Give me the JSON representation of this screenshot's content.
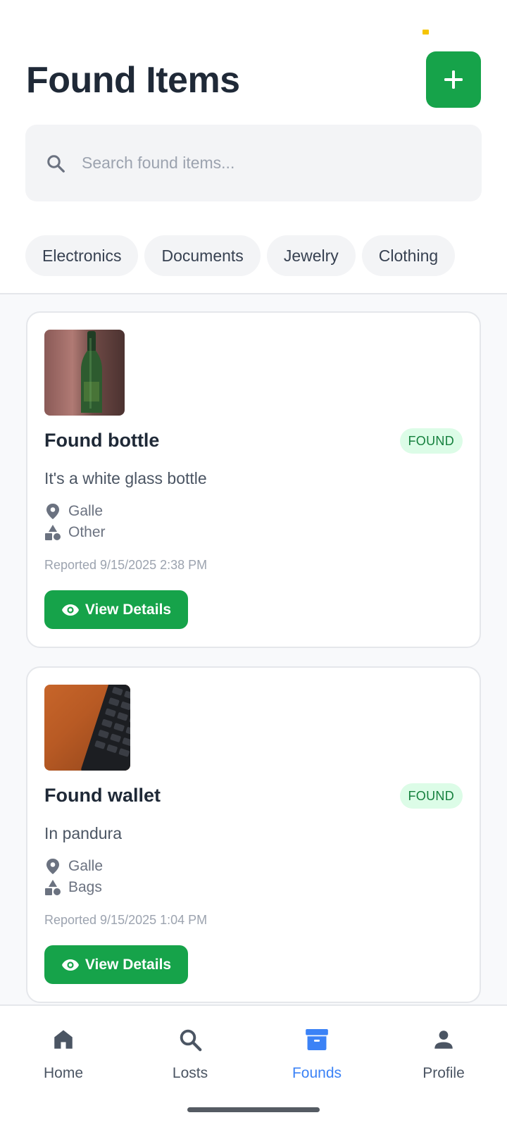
{
  "header": {
    "title": "Found Items",
    "add_icon": "plus-icon"
  },
  "search": {
    "placeholder": "Search found items...",
    "value": ""
  },
  "categories": [
    "Electronics",
    "Documents",
    "Jewelry",
    "Clothing"
  ],
  "items": [
    {
      "title": "Found bottle",
      "status": "FOUND",
      "description": "It's a white glass bottle",
      "location": "Galle",
      "category": "Other",
      "reported": "Reported 9/15/2025 2:38 PM",
      "action_label": "View Details"
    },
    {
      "title": "Found wallet",
      "status": "FOUND",
      "description": "In pandura",
      "location": "Galle",
      "category": "Bags",
      "reported": "Reported 9/15/2025 1:04 PM",
      "action_label": "View Details"
    }
  ],
  "nav": {
    "items": [
      {
        "label": "Home",
        "icon": "home-icon",
        "active": false
      },
      {
        "label": "Losts",
        "icon": "search-icon",
        "active": false
      },
      {
        "label": "Founds",
        "icon": "archive-box-icon",
        "active": true
      },
      {
        "label": "Profile",
        "icon": "person-icon",
        "active": false
      }
    ]
  },
  "colors": {
    "primary_green": "#16a34a",
    "active_nav": "#3b82f6",
    "badge_bg": "#dcfce7",
    "badge_text": "#15803d"
  }
}
